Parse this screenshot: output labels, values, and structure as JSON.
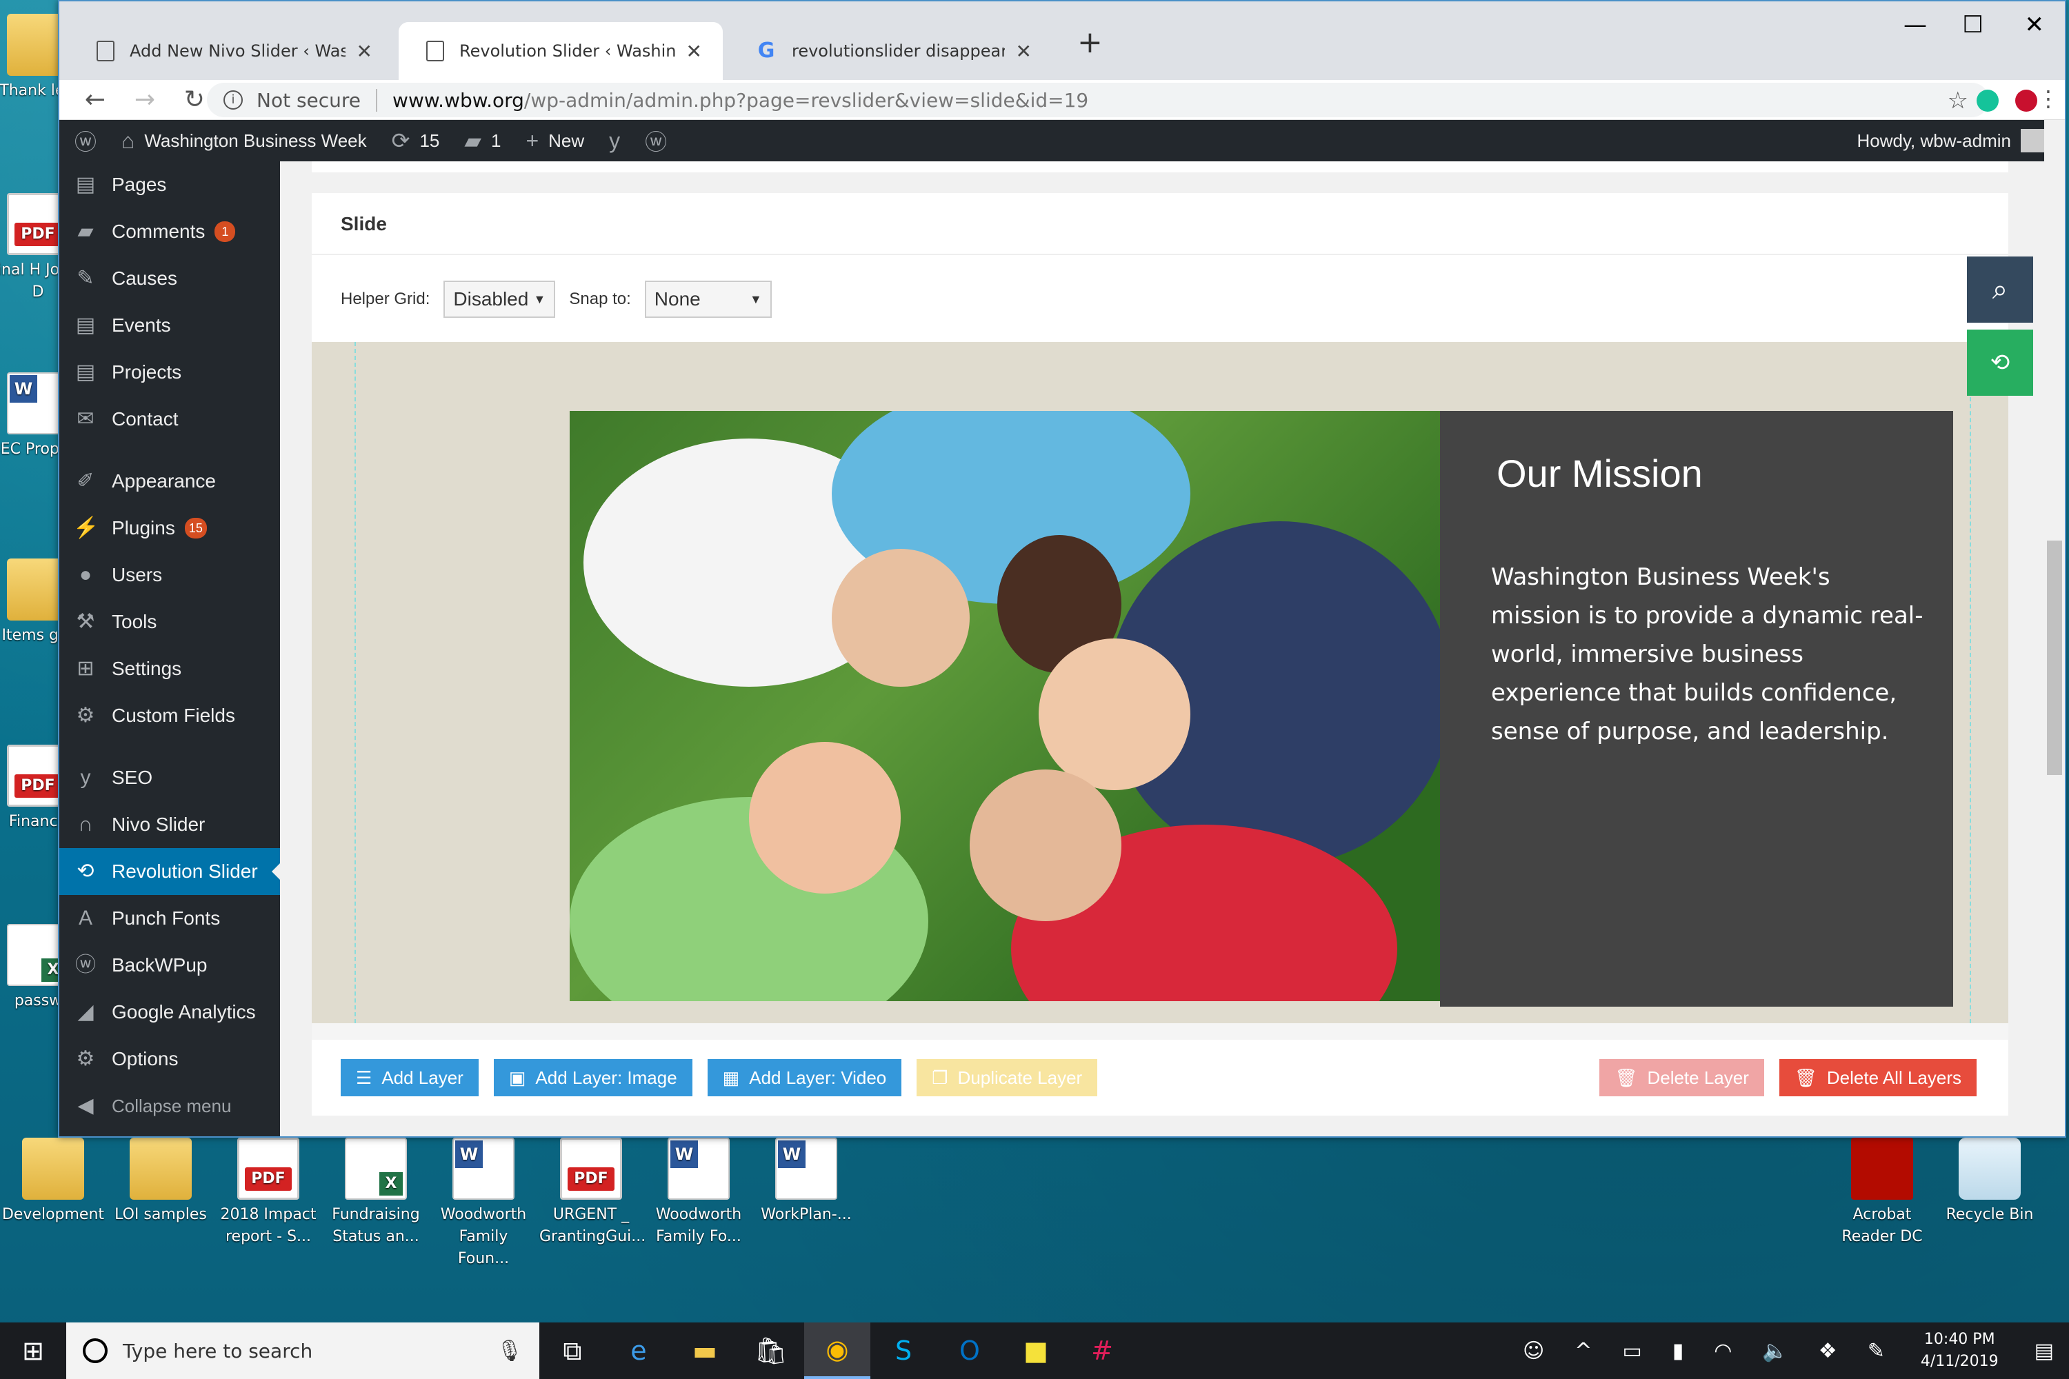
{
  "browser": {
    "tabs": [
      {
        "title": "Add New Nivo Slider ‹ Washington Business Week",
        "icon": "page-icon"
      },
      {
        "title": "Revolution Slider ‹ Washington Business Week",
        "icon": "page-icon"
      },
      {
        "title": "revolutionslider disappeared on wordpress",
        "icon": "google-icon"
      }
    ],
    "security": "Not secure",
    "url_host": "www.wbw.org",
    "url_path": "/wp-admin/admin.php?page=revslider&view=slide&id=19"
  },
  "adminbar": {
    "site_name": "Washington Business Week",
    "updates": "15",
    "comments": "1",
    "new_label": "New",
    "howdy": "Howdy, wbw-admin"
  },
  "sidebar": {
    "items": [
      {
        "label": "Pages",
        "icon": "pages-icon",
        "badge": ""
      },
      {
        "label": "Comments",
        "icon": "comments-icon",
        "badge": "1"
      },
      {
        "label": "Causes",
        "icon": "pin-icon",
        "badge": ""
      },
      {
        "label": "Events",
        "icon": "pages-icon",
        "badge": ""
      },
      {
        "label": "Projects",
        "icon": "pages-icon",
        "badge": ""
      },
      {
        "label": "Contact",
        "icon": "mail-icon",
        "badge": ""
      },
      {
        "label": "Appearance",
        "icon": "brush-icon",
        "badge": ""
      },
      {
        "label": "Plugins",
        "icon": "plug-icon",
        "badge": "15"
      },
      {
        "label": "Users",
        "icon": "user-icon",
        "badge": ""
      },
      {
        "label": "Tools",
        "icon": "wrench-icon",
        "badge": ""
      },
      {
        "label": "Settings",
        "icon": "settings-icon",
        "badge": ""
      },
      {
        "label": "Custom Fields",
        "icon": "gear-icon",
        "badge": ""
      },
      {
        "label": "SEO",
        "icon": "yoast-icon",
        "badge": ""
      },
      {
        "label": "Nivo Slider",
        "icon": "arch-icon",
        "badge": ""
      },
      {
        "label": "Revolution Slider",
        "icon": "refresh-icon",
        "badge": ""
      },
      {
        "label": "Punch Fonts",
        "icon": "font-icon",
        "badge": ""
      },
      {
        "label": "BackWPup",
        "icon": "wp-icon",
        "badge": ""
      },
      {
        "label": "Google Analytics",
        "icon": "chart-icon",
        "badge": ""
      },
      {
        "label": "Options",
        "icon": "gear-icon",
        "badge": ""
      }
    ],
    "collapse": "Collapse menu"
  },
  "editor": {
    "panel_title": "Slide",
    "helper_grid_label": "Helper Grid:",
    "helper_grid_value": "Disabled",
    "snap_label": "Snap to:",
    "snap_value": "None"
  },
  "slide": {
    "heading": "Our Mission",
    "body": "Washington Business Week's mission is to provide a dynamic real-world, immersive business experience that builds confidence, sense of purpose, and leadership."
  },
  "buttons": {
    "add_layer": "Add Layer",
    "add_image": "Add Layer: Image",
    "add_video": "Add Layer: Video",
    "duplicate": "Duplicate Layer",
    "delete": "Delete Layer",
    "delete_all": "Delete All Layers"
  },
  "desktop": {
    "left_icons": [
      "Thank lett",
      "Final H Jones D",
      "BEC Proposa",
      "Items gra",
      "Finance",
      "passw"
    ],
    "bottom_icons": [
      {
        "label": "Development",
        "type": "folder"
      },
      {
        "label": "LOI samples",
        "type": "folder"
      },
      {
        "label": "2018 Impact report - S...",
        "type": "pdf"
      },
      {
        "label": "Fundraising Status an...",
        "type": "xls"
      },
      {
        "label": "Woodworth Family Foun...",
        "type": "doc"
      },
      {
        "label": "URGENT _ GrantingGui...",
        "type": "pdf"
      },
      {
        "label": "Woodworth Family Fo...",
        "type": "doc"
      },
      {
        "label": "WorkPlan-...",
        "type": "doc"
      }
    ],
    "right_icons": [
      {
        "label": "Acrobat Reader DC",
        "type": "acro"
      },
      {
        "label": "Recycle Bin",
        "type": "bin"
      }
    ]
  },
  "taskbar": {
    "search_placeholder": "Type here to search",
    "time": "10:40 PM",
    "date": "4/11/2019"
  }
}
